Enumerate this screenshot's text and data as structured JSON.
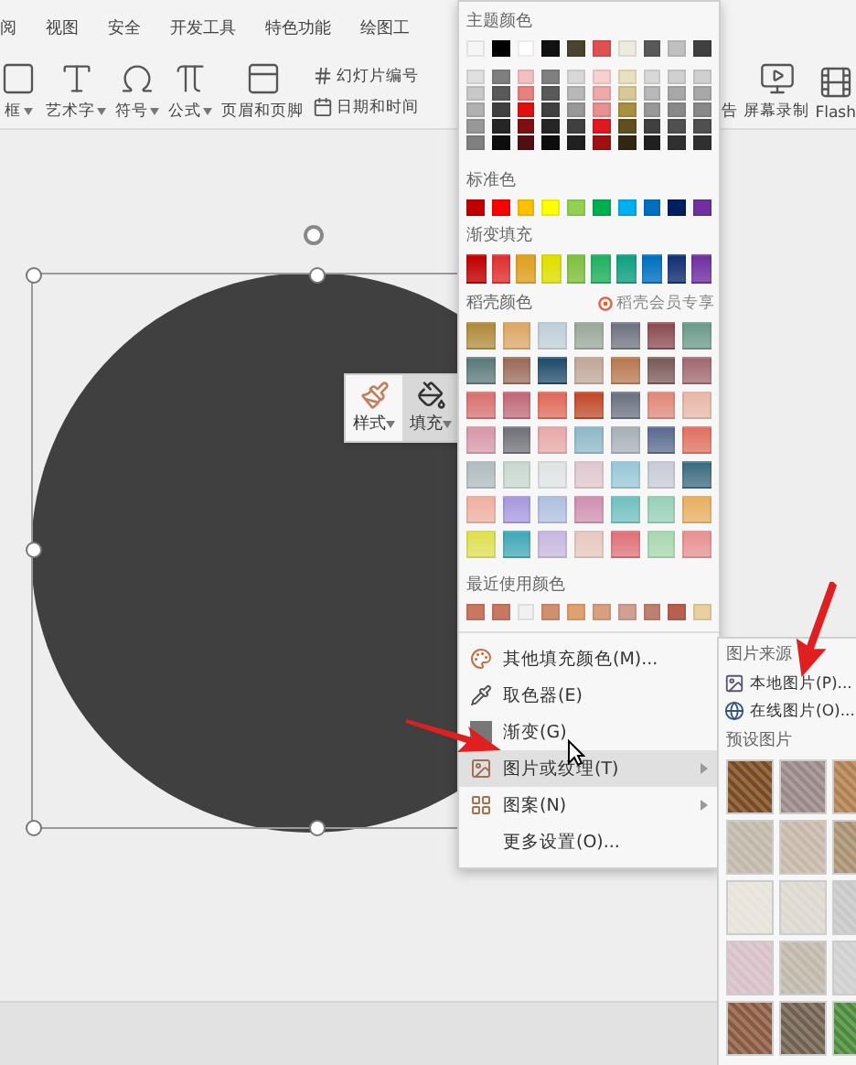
{
  "ribbon": {
    "tabs": [
      {
        "label": "阅",
        "selected": false
      },
      {
        "label": "视图",
        "selected": false
      },
      {
        "label": "安全",
        "selected": false
      },
      {
        "label": "开发工具",
        "selected": false
      },
      {
        "label": "特色功能",
        "selected": false
      },
      {
        "label": "绘图工",
        "selected": false
      }
    ],
    "tools": [
      {
        "label": "框",
        "kind": "textbox",
        "dropdown": true
      },
      {
        "label": "艺术字",
        "kind": "wordart",
        "dropdown": true
      },
      {
        "label": "符号",
        "kind": "symbol",
        "dropdown": true
      },
      {
        "label": "公式",
        "kind": "formula",
        "dropdown": true
      },
      {
        "label": "页眉和页脚",
        "kind": "header",
        "dropdown": false
      }
    ],
    "small_tools": [
      {
        "label": "幻灯片编号",
        "kind": "number"
      },
      {
        "label": "日期和时间",
        "kind": "date"
      }
    ],
    "right_tools": [
      {
        "label": "告",
        "kind": "none"
      },
      {
        "label": "屏幕录制",
        "kind": "record"
      },
      {
        "label": "Flash",
        "kind": "flash"
      }
    ]
  },
  "mini_toolbar": {
    "buttons": [
      {
        "label": "样式",
        "kind": "style",
        "selected": false
      },
      {
        "label": "填充",
        "kind": "fill",
        "selected": true
      }
    ]
  },
  "color_menu": {
    "theme_title": "主题颜色",
    "theme_colors": [
      {
        "color": "#f5f5f5",
        "shades": [
          {
            "color": "#e0e0e0"
          },
          {
            "color": "#c8c8c8"
          },
          {
            "color": "#b0b0b0"
          },
          {
            "color": "#989898"
          },
          {
            "color": "#808080"
          }
        ]
      },
      {
        "color": "#000000",
        "shades": [
          {
            "color": "#7f7f7f"
          },
          {
            "color": "#595959"
          },
          {
            "color": "#404040"
          },
          {
            "color": "#262626"
          },
          {
            "color": "#0d0d0d"
          }
        ]
      },
      {
        "color": "#ffffff",
        "shades": [
          {
            "color": "#f2c0c0"
          },
          {
            "color": "#e88080"
          },
          {
            "color": "#e01010"
          },
          {
            "color": "#801010"
          },
          {
            "color": "#501010"
          }
        ]
      },
      {
        "color": "#111111",
        "shades": [
          {
            "color": "#808080"
          },
          {
            "color": "#595959"
          },
          {
            "color": "#404040"
          },
          {
            "color": "#262626"
          },
          {
            "color": "#0d0d0d"
          }
        ]
      },
      {
        "color": "#4a4330",
        "shades": [
          {
            "color": "#d8d8d8"
          },
          {
            "color": "#b8b8b8"
          },
          {
            "color": "#989898"
          },
          {
            "color": "#404040"
          },
          {
            "color": "#202020"
          }
        ]
      },
      {
        "color": "#e05050",
        "shades": [
          {
            "color": "#f8d0d0"
          },
          {
            "color": "#f0a8a8"
          },
          {
            "color": "#e89090"
          },
          {
            "color": "#e01820"
          },
          {
            "color": "#a01010"
          }
        ]
      },
      {
        "color": "#eeece1",
        "shades": [
          {
            "color": "#e8e0c0"
          },
          {
            "color": "#d8c898"
          },
          {
            "color": "#a89040"
          },
          {
            "color": "#605020"
          },
          {
            "color": "#302810"
          }
        ]
      },
      {
        "color": "#595959",
        "shades": [
          {
            "color": "#d8d8d8"
          },
          {
            "color": "#b8b8b8"
          },
          {
            "color": "#989898"
          },
          {
            "color": "#404040"
          },
          {
            "color": "#202020"
          }
        ]
      },
      {
        "color": "#c0c0c0",
        "shades": [
          {
            "color": "#d0d0d0"
          },
          {
            "color": "#a8a8a8"
          },
          {
            "color": "#888888"
          },
          {
            "color": "#505050"
          },
          {
            "color": "#303030"
          }
        ]
      },
      {
        "color": "#404040",
        "shades": [
          {
            "color": "#d0d0d0"
          },
          {
            "color": "#a8a8a8"
          },
          {
            "color": "#888888"
          },
          {
            "color": "#505050"
          },
          {
            "color": "#303030"
          }
        ]
      }
    ],
    "standard_title": "标准色",
    "standard_colors": [
      {
        "color": "#c00000"
      },
      {
        "color": "#ff0000"
      },
      {
        "color": "#ffc000"
      },
      {
        "color": "#ffff00"
      },
      {
        "color": "#92d050"
      },
      {
        "color": "#00b050"
      },
      {
        "color": "#00b0f0"
      },
      {
        "color": "#0070c0"
      },
      {
        "color": "#002060"
      },
      {
        "color": "#7030a0"
      }
    ],
    "gradient_title": "渐变填充",
    "gradient_colors": [
      {
        "color": "#c00000"
      },
      {
        "color": "#e03030"
      },
      {
        "color": "#e0a020"
      },
      {
        "color": "#e0e000"
      },
      {
        "color": "#80c040"
      },
      {
        "color": "#20b060"
      },
      {
        "color": "#10a080"
      },
      {
        "color": "#0070c0"
      },
      {
        "color": "#103070"
      },
      {
        "color": "#7030a0"
      }
    ],
    "docer_title": "稻壳颜色",
    "docer_member": "稻壳会员专享",
    "docer_colors": [
      {
        "color": "#b08a3a"
      },
      {
        "color": "#dca864"
      },
      {
        "color": "#c0d0d8"
      },
      {
        "color": "#9aa89a"
      },
      {
        "color": "#6e7280"
      },
      {
        "color": "#8a4a50"
      },
      {
        "color": "#6a9a8a"
      },
      {
        "color": "#5a7878"
      },
      {
        "color": "#9a6a58"
      },
      {
        "color": "#1f4a6a"
      },
      {
        "color": "#c0a898"
      },
      {
        "color": "#b87850"
      },
      {
        "color": "#7a5a58"
      },
      {
        "color": "#a06870"
      },
      {
        "color": "#d87070"
      },
      {
        "color": "#c06878"
      },
      {
        "color": "#e06858"
      },
      {
        "color": "#c04828"
      },
      {
        "color": "#6a7080"
      },
      {
        "color": "#e08878"
      },
      {
        "color": "#e8b8a8"
      },
      {
        "color": "#d898a8"
      },
      {
        "color": "#707078"
      },
      {
        "color": "#e8a8a8"
      },
      {
        "color": "#90b8c8"
      },
      {
        "color": "#a8b0b8"
      },
      {
        "color": "#5a6a90"
      },
      {
        "color": "#e07060"
      },
      {
        "color": "#b0bcc0"
      },
      {
        "color": "#c8d8d0"
      },
      {
        "color": "#e0e4e4"
      },
      {
        "color": "#e0c8d0"
      },
      {
        "color": "#98c8d8"
      },
      {
        "color": "#c8ccd8"
      },
      {
        "color": "#3a6a80"
      },
      {
        "color": "#f0b0a0"
      },
      {
        "color": "#a898e0"
      },
      {
        "color": "#b0c0e0"
      },
      {
        "color": "#d090b0"
      },
      {
        "color": "#70c0c0"
      },
      {
        "color": "#98d0b8"
      },
      {
        "color": "#e8b060"
      },
      {
        "color": "#e0e050"
      },
      {
        "color": "#40a8b8"
      },
      {
        "color": "#c8b8e0"
      },
      {
        "color": "#e8c8c0"
      },
      {
        "color": "#e07078"
      },
      {
        "color": "#a8d8b0"
      },
      {
        "color": "#e89090"
      }
    ],
    "recent_title": "最近使用颜色",
    "recent_colors": [
      {
        "color": "#c87860"
      },
      {
        "color": "#c87861"
      },
      {
        "color": "#f0f0f0"
      },
      {
        "color": "#d09070"
      },
      {
        "color": "#e0a070"
      },
      {
        "color": "#d8a080"
      },
      {
        "color": "#d0a090"
      },
      {
        "color": "#c08070"
      },
      {
        "color": "#b86050"
      },
      {
        "color": "#e8d0a0"
      }
    ],
    "items": [
      {
        "label": "其他填充颜色(M)...",
        "kind": "palette",
        "submenu": false,
        "selected": false
      },
      {
        "label": "取色器(E)",
        "kind": "eyedropper",
        "submenu": false,
        "selected": false
      },
      {
        "label": "渐变(G)",
        "kind": "gradient",
        "submenu": false,
        "selected": false
      },
      {
        "label": "图片或纹理(T)",
        "kind": "texture",
        "submenu": true,
        "selected": true
      },
      {
        "label": "图案(N)",
        "kind": "pattern",
        "submenu": true,
        "selected": false
      },
      {
        "label": "更多设置(O)...",
        "kind": "none",
        "submenu": false,
        "selected": false
      }
    ]
  },
  "texture_menu": {
    "source_title": "图片来源",
    "items": [
      {
        "label": "本地图片(P)...",
        "kind": "local"
      },
      {
        "label": "在线图片(O)...",
        "kind": "online"
      }
    ],
    "preset_title": "预设图片",
    "textures": [
      {
        "color": "#7a4a20"
      },
      {
        "color": "#9a8888"
      },
      {
        "color": "#b08050"
      },
      {
        "color": "#c0b8a8"
      },
      {
        "color": "#c8b8a9"
      },
      {
        "color": "#a89070"
      },
      {
        "color": "#e8e4dc"
      },
      {
        "color": "#ddd8d0"
      },
      {
        "color": "#c8c8c8"
      },
      {
        "color": "#d8c0c8"
      },
      {
        "color": "#c0b8aa"
      },
      {
        "color": "#d0d0d0"
      },
      {
        "color": "#8a5a40"
      },
      {
        "color": "#706050"
      },
      {
        "color": "#4a8a3a"
      }
    ]
  }
}
